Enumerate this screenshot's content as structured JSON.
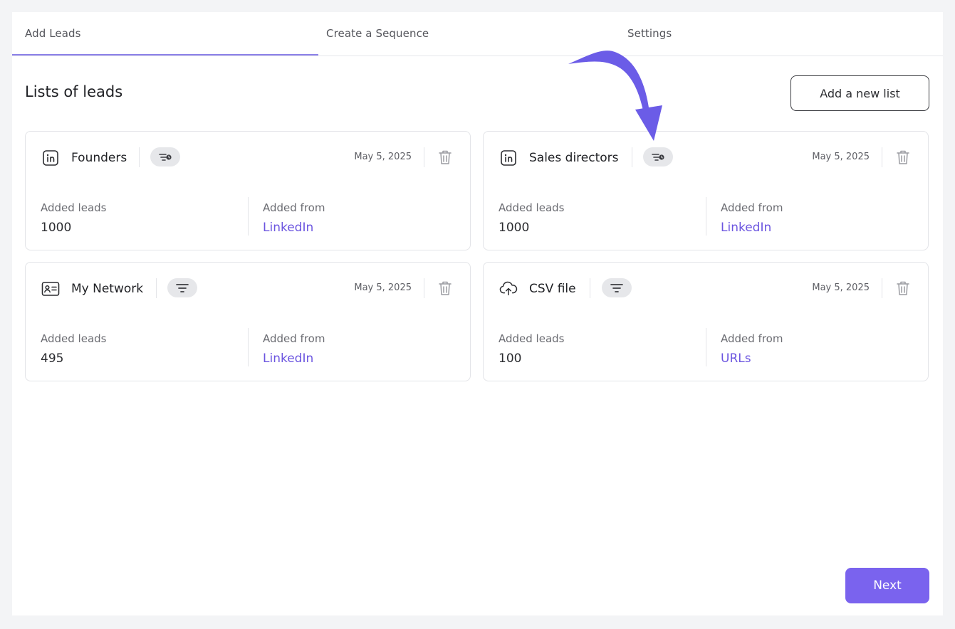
{
  "tabs": [
    {
      "label": "Add Leads",
      "active": true
    },
    {
      "label": "Create a Sequence",
      "active": false
    },
    {
      "label": "Settings",
      "active": false
    }
  ],
  "page": {
    "title": "Lists of leads",
    "add_list_label": "Add a new list",
    "next_label": "Next"
  },
  "lists": [
    {
      "name": "Founders",
      "source_icon": "linkedin-icon",
      "filter_icon": "filter-clock-icon",
      "date": "May 5, 2025",
      "leads_label": "Added leads",
      "leads": "1000",
      "from_label": "Added from",
      "from": "LinkedIn"
    },
    {
      "name": "Sales directors",
      "source_icon": "linkedin-icon",
      "filter_icon": "filter-clock-icon",
      "date": "May 5, 2025",
      "leads_label": "Added leads",
      "leads": "1000",
      "from_label": "Added from",
      "from": "LinkedIn"
    },
    {
      "name": "My Network",
      "source_icon": "contact-card-icon",
      "filter_icon": "filter-icon",
      "date": "May 5, 2025",
      "leads_label": "Added leads",
      "leads": "495",
      "from_label": "Added from",
      "from": "LinkedIn"
    },
    {
      "name": "CSV file",
      "source_icon": "cloud-upload-icon",
      "filter_icon": "filter-icon",
      "date": "May 5, 2025",
      "leads_label": "Added leads",
      "leads": "100",
      "from_label": "Added from",
      "from": "URLs"
    }
  ],
  "colors": {
    "accent": "#7a63ee",
    "link": "#6c56e0",
    "tab_underline": "#8b80e8",
    "annotation_arrow": "#6b5ce7"
  }
}
